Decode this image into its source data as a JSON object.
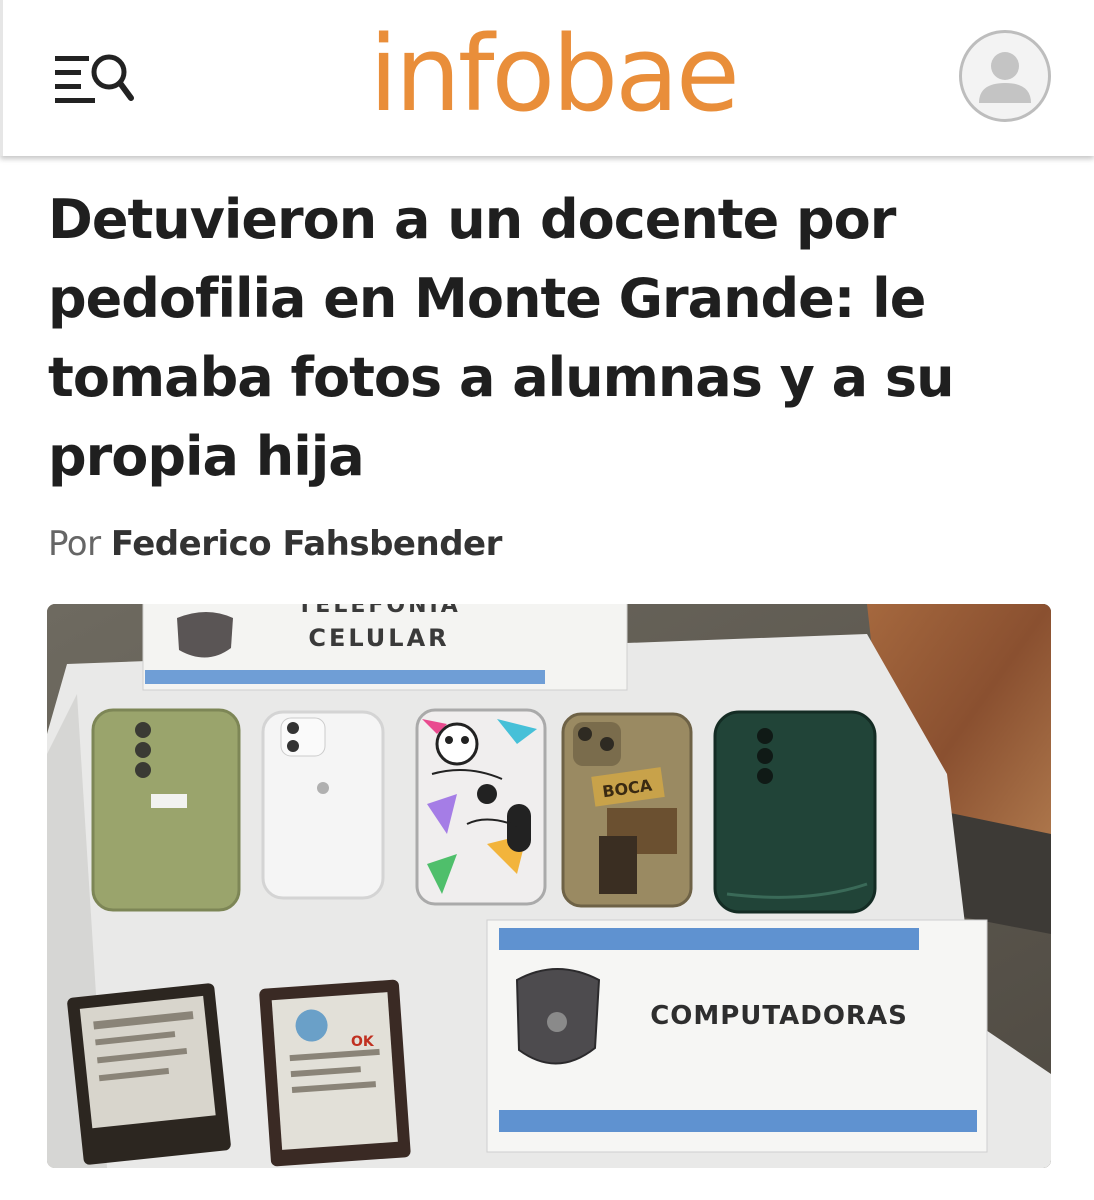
{
  "header": {
    "logo_text": "infobae",
    "menu_icon": "menu-search-icon",
    "profile_icon": "user-avatar-icon",
    "brand_color": "#e98e3a"
  },
  "article": {
    "headline": "Detuvieron a un docente por pedofilia en Monte Grande: le tomaba fotos a alumnas y a su propia hija",
    "byline_prefix": "Por",
    "author": "Federico Fahsbender"
  },
  "photo": {
    "sign_top_line1": "TELEFONIA",
    "sign_top_line2": "CELULAR",
    "sign_bottom": "COMPUTADORAS",
    "phone_case_text": "BOCA",
    "drive_label": "OK"
  }
}
